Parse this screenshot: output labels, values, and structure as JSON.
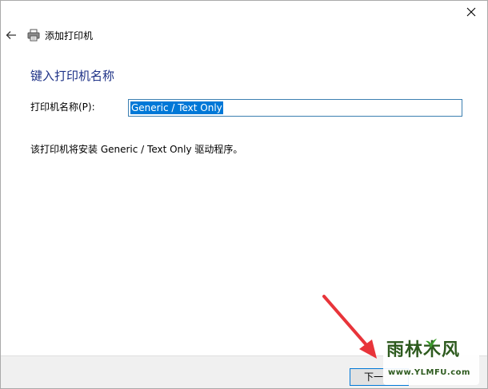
{
  "window": {
    "title": "添加打印机"
  },
  "page": {
    "heading": "键入打印机名称",
    "name_label": "打印机名称(P):",
    "name_value": "Generic / Text Only",
    "info_text": "该打印机将安装 Generic / Text Only 驱动程序。"
  },
  "footer": {
    "next_label": "下一"
  },
  "watermark": {
    "main": "雨林木风",
    "url": "www.YLMFU.com"
  },
  "colors": {
    "heading": "#1e3287",
    "selection": "#0078d7",
    "annotation_arrow": "#e8343a",
    "watermark": "#2d5a1e"
  },
  "icons": [
    "close-icon",
    "back-arrow-icon",
    "printer-icon"
  ]
}
